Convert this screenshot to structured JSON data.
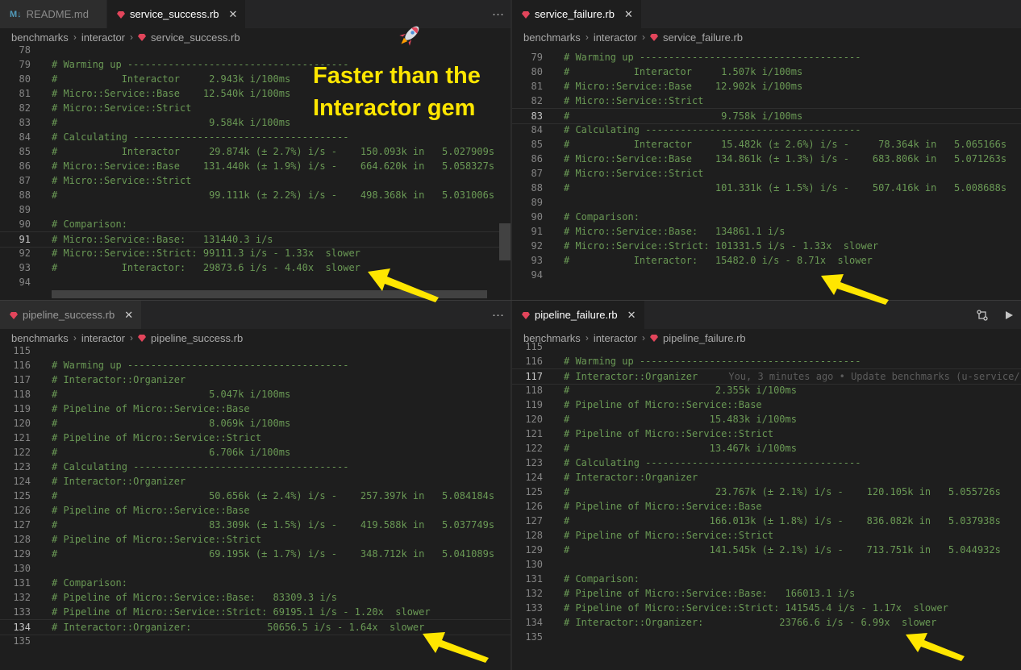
{
  "annotation": {
    "text_line1": "Faster than the",
    "text_line2": "Interactor gem"
  },
  "colors": {
    "comment": "#6a9955",
    "arrow": "#ffe600",
    "ruby": "#e2455b"
  },
  "panes": {
    "top_left": {
      "tabs": [
        {
          "label": "README.md",
          "icon": "markdown-icon",
          "prefix": "M↓"
        },
        {
          "label": "service_success.rb",
          "icon": "ruby-icon",
          "active": true
        }
      ],
      "more": "···",
      "crumbs": [
        "benchmarks",
        "interactor",
        "service_success.rb"
      ],
      "lines": [
        {
          "n": "78",
          "t": ""
        },
        {
          "n": "79",
          "t": "# Warming up --------------------------------------"
        },
        {
          "n": "80",
          "t": "#           Interactor     2.943k i/100ms"
        },
        {
          "n": "81",
          "t": "# Micro::Service::Base    12.540k i/100ms"
        },
        {
          "n": "82",
          "t": "# Micro::Service::Strict"
        },
        {
          "n": "83",
          "t": "#                          9.584k i/100ms"
        },
        {
          "n": "84",
          "t": "# Calculating -------------------------------------"
        },
        {
          "n": "85",
          "t": "#           Interactor     29.874k (± 2.7%) i/s -    150.093k in   5.027909s"
        },
        {
          "n": "86",
          "t": "# Micro::Service::Base    131.440k (± 1.9%) i/s -    664.620k in   5.058327s"
        },
        {
          "n": "87",
          "t": "# Micro::Service::Strict"
        },
        {
          "n": "88",
          "t": "#                          99.111k (± 2.2%) i/s -    498.368k in   5.031006s"
        },
        {
          "n": "89",
          "t": ""
        },
        {
          "n": "90",
          "t": "# Comparison:"
        },
        {
          "n": "91",
          "t": "# Micro::Service::Base:   131440.3 i/s",
          "cur": true
        },
        {
          "n": "92",
          "t": "# Micro::Service::Strict: 99111.3 i/s - 1.33x  slower"
        },
        {
          "n": "93",
          "t": "#           Interactor:   29873.6 i/s - 4.40x  slower"
        },
        {
          "n": "94",
          "t": ""
        }
      ]
    },
    "top_right": {
      "tabs": [
        {
          "label": "service_failure.rb",
          "icon": "ruby-icon",
          "active": true
        }
      ],
      "crumbs": [
        "benchmarks",
        "interactor",
        "service_failure.rb"
      ],
      "lines": [
        {
          "n": "79",
          "t": "# Warming up --------------------------------------"
        },
        {
          "n": "80",
          "t": "#           Interactor     1.507k i/100ms"
        },
        {
          "n": "81",
          "t": "# Micro::Service::Base    12.902k i/100ms"
        },
        {
          "n": "82",
          "t": "# Micro::Service::Strict"
        },
        {
          "n": "83",
          "t": "#                          9.758k i/100ms",
          "cur": true
        },
        {
          "n": "84",
          "t": "# Calculating -------------------------------------"
        },
        {
          "n": "85",
          "t": "#           Interactor     15.482k (± 2.6%) i/s -     78.364k in   5.065166s"
        },
        {
          "n": "86",
          "t": "# Micro::Service::Base    134.861k (± 1.3%) i/s -    683.806k in   5.071263s"
        },
        {
          "n": "87",
          "t": "# Micro::Service::Strict"
        },
        {
          "n": "88",
          "t": "#                         101.331k (± 1.5%) i/s -    507.416k in   5.008688s"
        },
        {
          "n": "89",
          "t": ""
        },
        {
          "n": "90",
          "t": "# Comparison:"
        },
        {
          "n": "91",
          "t": "# Micro::Service::Base:   134861.1 i/s"
        },
        {
          "n": "92",
          "t": "# Micro::Service::Strict: 101331.5 i/s - 1.33x  slower"
        },
        {
          "n": "93",
          "t": "#           Interactor:   15482.0 i/s - 8.71x  slower"
        },
        {
          "n": "94",
          "t": ""
        }
      ]
    },
    "bottom_left": {
      "tabs": [
        {
          "label": "pipeline_success.rb",
          "icon": "ruby-icon"
        }
      ],
      "more": "···",
      "crumbs": [
        "benchmarks",
        "interactor",
        "pipeline_success.rb"
      ],
      "lines": [
        {
          "n": "115",
          "t": ""
        },
        {
          "n": "116",
          "t": "# Warming up --------------------------------------"
        },
        {
          "n": "117",
          "t": "# Interactor::Organizer"
        },
        {
          "n": "118",
          "t": "#                          5.047k i/100ms"
        },
        {
          "n": "119",
          "t": "# Pipeline of Micro::Service::Base"
        },
        {
          "n": "120",
          "t": "#                          8.069k i/100ms"
        },
        {
          "n": "121",
          "t": "# Pipeline of Micro::Service::Strict"
        },
        {
          "n": "122",
          "t": "#                          6.706k i/100ms"
        },
        {
          "n": "123",
          "t": "# Calculating -------------------------------------"
        },
        {
          "n": "124",
          "t": "# Interactor::Organizer"
        },
        {
          "n": "125",
          "t": "#                          50.656k (± 2.4%) i/s -    257.397k in   5.084184s"
        },
        {
          "n": "126",
          "t": "# Pipeline of Micro::Service::Base"
        },
        {
          "n": "127",
          "t": "#                          83.309k (± 1.5%) i/s -    419.588k in   5.037749s"
        },
        {
          "n": "128",
          "t": "# Pipeline of Micro::Service::Strict"
        },
        {
          "n": "129",
          "t": "#                          69.195k (± 1.7%) i/s -    348.712k in   5.041089s"
        },
        {
          "n": "130",
          "t": ""
        },
        {
          "n": "131",
          "t": "# Comparison:"
        },
        {
          "n": "132",
          "t": "# Pipeline of Micro::Service::Base:   83309.3 i/s"
        },
        {
          "n": "133",
          "t": "# Pipeline of Micro::Service::Strict: 69195.1 i/s - 1.20x  slower"
        },
        {
          "n": "134",
          "t": "# Interactor::Organizer:             50656.5 i/s - 1.64x  slower",
          "cur": true
        },
        {
          "n": "135",
          "t": ""
        }
      ]
    },
    "bottom_right": {
      "tabs": [
        {
          "label": "pipeline_failure.rb",
          "icon": "ruby-icon",
          "active": true
        }
      ],
      "crumbs": [
        "benchmarks",
        "interactor",
        "pipeline_failure.rb"
      ],
      "lines": [
        {
          "n": "115",
          "t": ""
        },
        {
          "n": "116",
          "t": "# Warming up --------------------------------------"
        },
        {
          "n": "117",
          "t": "# Interactor::Organizer",
          "blame": "      You, 3 minutes ago • Update benchmarks (u-service/",
          "cur": true
        },
        {
          "n": "118",
          "t": "#                         2.355k i/100ms"
        },
        {
          "n": "119",
          "t": "# Pipeline of Micro::Service::Base"
        },
        {
          "n": "120",
          "t": "#                        15.483k i/100ms"
        },
        {
          "n": "121",
          "t": "# Pipeline of Micro::Service::Strict"
        },
        {
          "n": "122",
          "t": "#                        13.467k i/100ms"
        },
        {
          "n": "123",
          "t": "# Calculating -------------------------------------"
        },
        {
          "n": "124",
          "t": "# Interactor::Organizer"
        },
        {
          "n": "125",
          "t": "#                         23.767k (± 2.1%) i/s -    120.105k in   5.055726s"
        },
        {
          "n": "126",
          "t": "# Pipeline of Micro::Service::Base"
        },
        {
          "n": "127",
          "t": "#                        166.013k (± 1.8%) i/s -    836.082k in   5.037938s"
        },
        {
          "n": "128",
          "t": "# Pipeline of Micro::Service::Strict"
        },
        {
          "n": "129",
          "t": "#                        141.545k (± 2.1%) i/s -    713.751k in   5.044932s"
        },
        {
          "n": "130",
          "t": ""
        },
        {
          "n": "131",
          "t": "# Comparison:"
        },
        {
          "n": "132",
          "t": "# Pipeline of Micro::Service::Base:   166013.1 i/s"
        },
        {
          "n": "133",
          "t": "# Pipeline of Micro::Service::Strict: 141545.4 i/s - 1.17x  slower"
        },
        {
          "n": "134",
          "t": "# Interactor::Organizer:             23766.6 i/s - 6.99x  slower"
        },
        {
          "n": "135",
          "t": ""
        }
      ]
    }
  }
}
